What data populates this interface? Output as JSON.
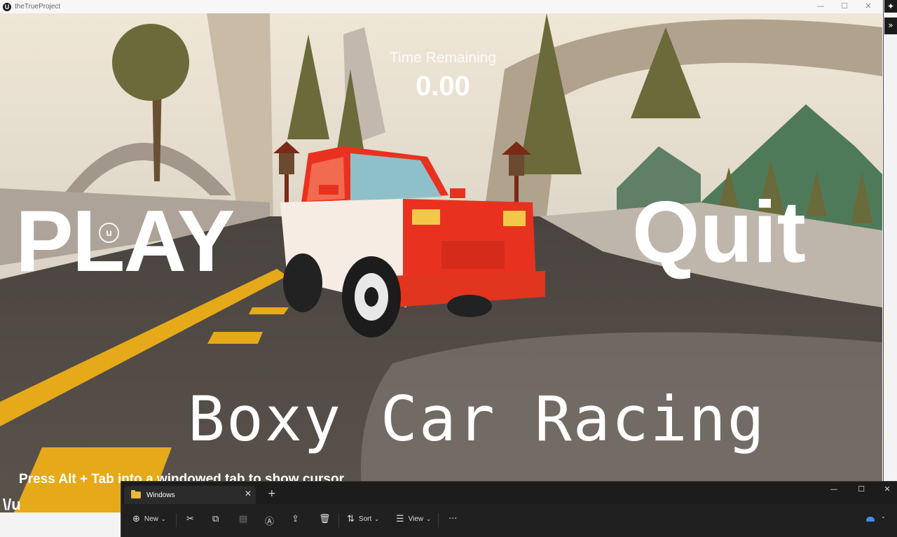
{
  "game_window": {
    "title": "theTrueProject",
    "logo_text": "U",
    "controls": {
      "minimize": "—",
      "maximize": "☐",
      "close": "✕"
    }
  },
  "hud": {
    "time_label": "Time Remaining",
    "time_value": "0.00"
  },
  "menu": {
    "play_label": "PLAY",
    "quit_label": "Quit",
    "game_title": "Boxy Car Racing",
    "hint": "Press Alt + Tab into a windowed tab to show cursor",
    "watermark": "u",
    "corner_mark": "\\/u"
  },
  "explorer": {
    "tab_label": "Windows",
    "tab_close": "✕",
    "new_tab": "+",
    "window_controls": {
      "minimize": "—",
      "maximize": "☐",
      "close": "✕"
    },
    "toolbar": {
      "new_label": "New",
      "sort_label": "Sort",
      "view_label": "View",
      "more_label": "···"
    }
  },
  "side": {
    "puzzle_icon": "✦",
    "expand_icon": "»"
  },
  "colors": {
    "car_body": "#e8321f",
    "road_line": "#e6a91a",
    "explorer_bg": "#202020",
    "accent_cloud": "#3b8eea"
  }
}
